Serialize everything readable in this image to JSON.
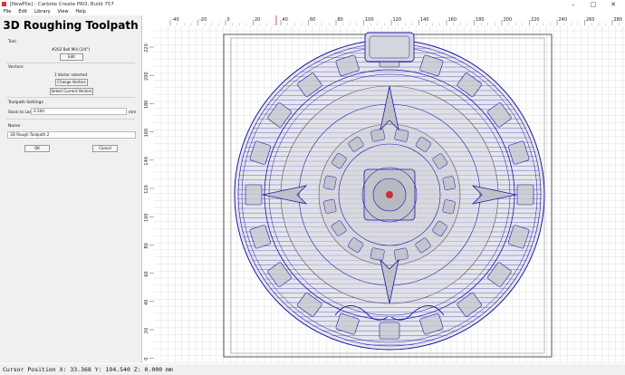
{
  "window": {
    "title": "[NewFile] - Carbide Create PRO, Build 757"
  },
  "menu": [
    "File",
    "Edit",
    "Library",
    "View",
    "Help"
  ],
  "panel": {
    "title": "3D Roughing Toolpath",
    "tool": {
      "header": "Tool",
      "name": "#202 Ball Mill (1/4\")",
      "edit_label": "Edit"
    },
    "vectors": {
      "header": "Vectors",
      "selected_text": "1 Vector selected",
      "change_label": "Change Vectors",
      "select_current_label": "Select Current Vectors"
    },
    "settings": {
      "header": "Toolpath Settings",
      "stock_label": "Stock to Leave:",
      "stock_value": "0.500",
      "stock_unit": "mm"
    },
    "name": {
      "header": "Name",
      "value": "3D Rough Toolpath 2"
    },
    "ok_label": "OK",
    "cancel_label": "Cancel"
  },
  "ruler": {
    "x_labels": [
      "-40",
      "-20",
      "0",
      "20",
      "40",
      "60",
      "80",
      "100",
      "120",
      "140",
      "160",
      "180",
      "200",
      "220",
      "240",
      "260",
      "280"
    ],
    "y_labels": [
      "220",
      "200",
      "180",
      "160",
      "140",
      "120",
      "100",
      "80",
      "60",
      "40",
      "20",
      "0"
    ]
  },
  "status": {
    "cursor": "Cursor Position X: 33.368 Y: 194.540 Z: 0.000 mm"
  },
  "colors": {
    "vector": "#1a1aa8",
    "selected": "#d03030",
    "grid": "#d8d8d8",
    "panel": "#f0f0f0"
  }
}
